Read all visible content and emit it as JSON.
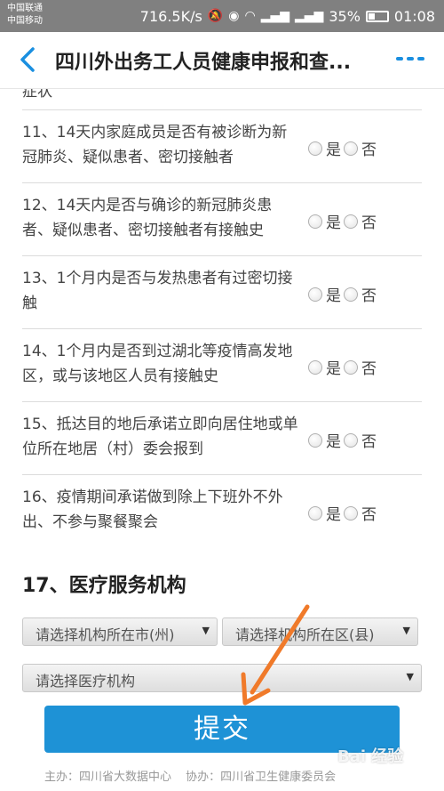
{
  "status_bar": {
    "carrier1": "中国联通",
    "carrier2": "中国移动",
    "speed": "716.5K/s",
    "battery": "35%",
    "time": "01:08",
    "battery_level": 0.35
  },
  "header": {
    "title": "四川外出务工人员健康申报和查...",
    "back_icon": "chevron-left-icon",
    "more_icon": "more-icon",
    "accent": "#1a8fe0"
  },
  "questions": [
    {
      "text": "11、14天内家庭成员是否有被诊断为新冠肺炎、疑似患者、密切接触者",
      "yes": "是",
      "no": "否"
    },
    {
      "text": "12、14天内是否与确诊的新冠肺炎患者、疑似患者、密切接触者有接触史",
      "yes": "是",
      "no": "否"
    },
    {
      "text": "13、1个月内是否与发热患者有过密切接触",
      "yes": "是",
      "no": "否"
    },
    {
      "text": "14、1个月内是否到过湖北等疫情高发地区，或与该地区人员有接触史",
      "yes": "是",
      "no": "否"
    },
    {
      "text": "15、抵达目的地后承诺立即向居住地或单位所在地居（村）委会报到",
      "yes": "是",
      "no": "否"
    }
  ],
  "question16": {
    "text": "16、疫情期间承诺做到除上下班外不外出、不参与聚餐聚会",
    "yes": "是",
    "no": "否"
  },
  "section17": {
    "title": "17、医疗服务机构",
    "select_city": "请选择机构所在市(州)",
    "select_district": "请选择机构所在区(县)",
    "select_institution": "请选择医疗机构"
  },
  "submit_label": "提交",
  "submit_color": "#1e92d6",
  "footer": {
    "host": "主办：四川省大数据中心",
    "co_host": "协办：四川省卫生健康委员会"
  },
  "watermark": "Bai 经验"
}
